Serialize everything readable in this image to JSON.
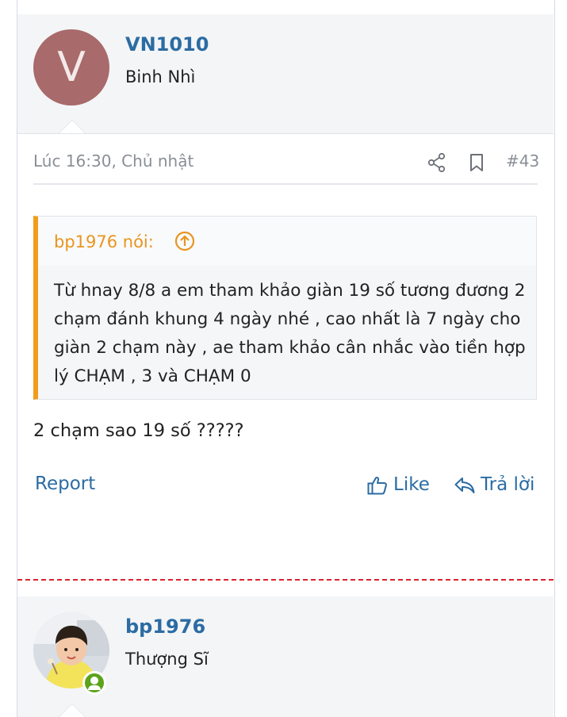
{
  "post": {
    "author": {
      "initial": "V",
      "name": "VN1010",
      "title": "Binh Nhì",
      "avatar_color": "#a86a6a"
    },
    "meta": {
      "date": "Lúc 16:30, Chủ nhật",
      "number": "#43",
      "share_icon": "share-icon",
      "bookmark_icon": "bookmark-icon"
    },
    "quote": {
      "author": "bp1976 nói:",
      "text": "Từ hnay 8/8 a em tham khảo giàn 19 số tương đương 2 chạm đánh khung 4 ngày nhé , cao nhất là 7 ngày cho giàn 2 chạm này , ae tham khảo cân nhắc vào tiền hợp lý CHẠM , 3 và CHẠM 0",
      "accent_color": "#f39c1c"
    },
    "body": "2 chạm sao 19 số ?????",
    "actions": {
      "report": "Report",
      "like": "Like",
      "reply": "Trả lời"
    }
  },
  "next_post": {
    "author": {
      "name": "bp1976",
      "title": "Thượng Sĩ",
      "online_icon": "online-user-icon"
    }
  },
  "colors": {
    "link": "#2b6ca3",
    "divider": "#d9232e",
    "header_bg": "#f4f5f7"
  }
}
